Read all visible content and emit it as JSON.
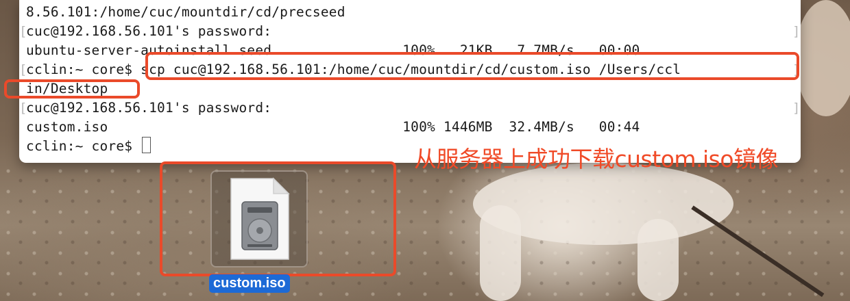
{
  "terminal": {
    "lines": [
      "8.56.101:/home/cuc/mountdir/cd/precseed",
      "cuc@192.168.56.101's password:",
      "ubuntu-server-autoinstall.seed                100%   21KB   7.7MB/s   00:00",
      "cclin:~ core$ scp cuc@192.168.56.101:/home/cuc/mountdir/cd/custom.iso /Users/ccl",
      "in/Desktop",
      "cuc@192.168.56.101's password:",
      "custom.iso                                    100% 1446MB  32.4MB/s   00:44",
      "cclin:~ core$ "
    ]
  },
  "annotation": {
    "text": "从服务器上成功下载custom.iso镜像",
    "color": "#ea4a2a"
  },
  "desktop": {
    "file_label": "custom.iso",
    "file_icon": "disk-image-icon"
  }
}
